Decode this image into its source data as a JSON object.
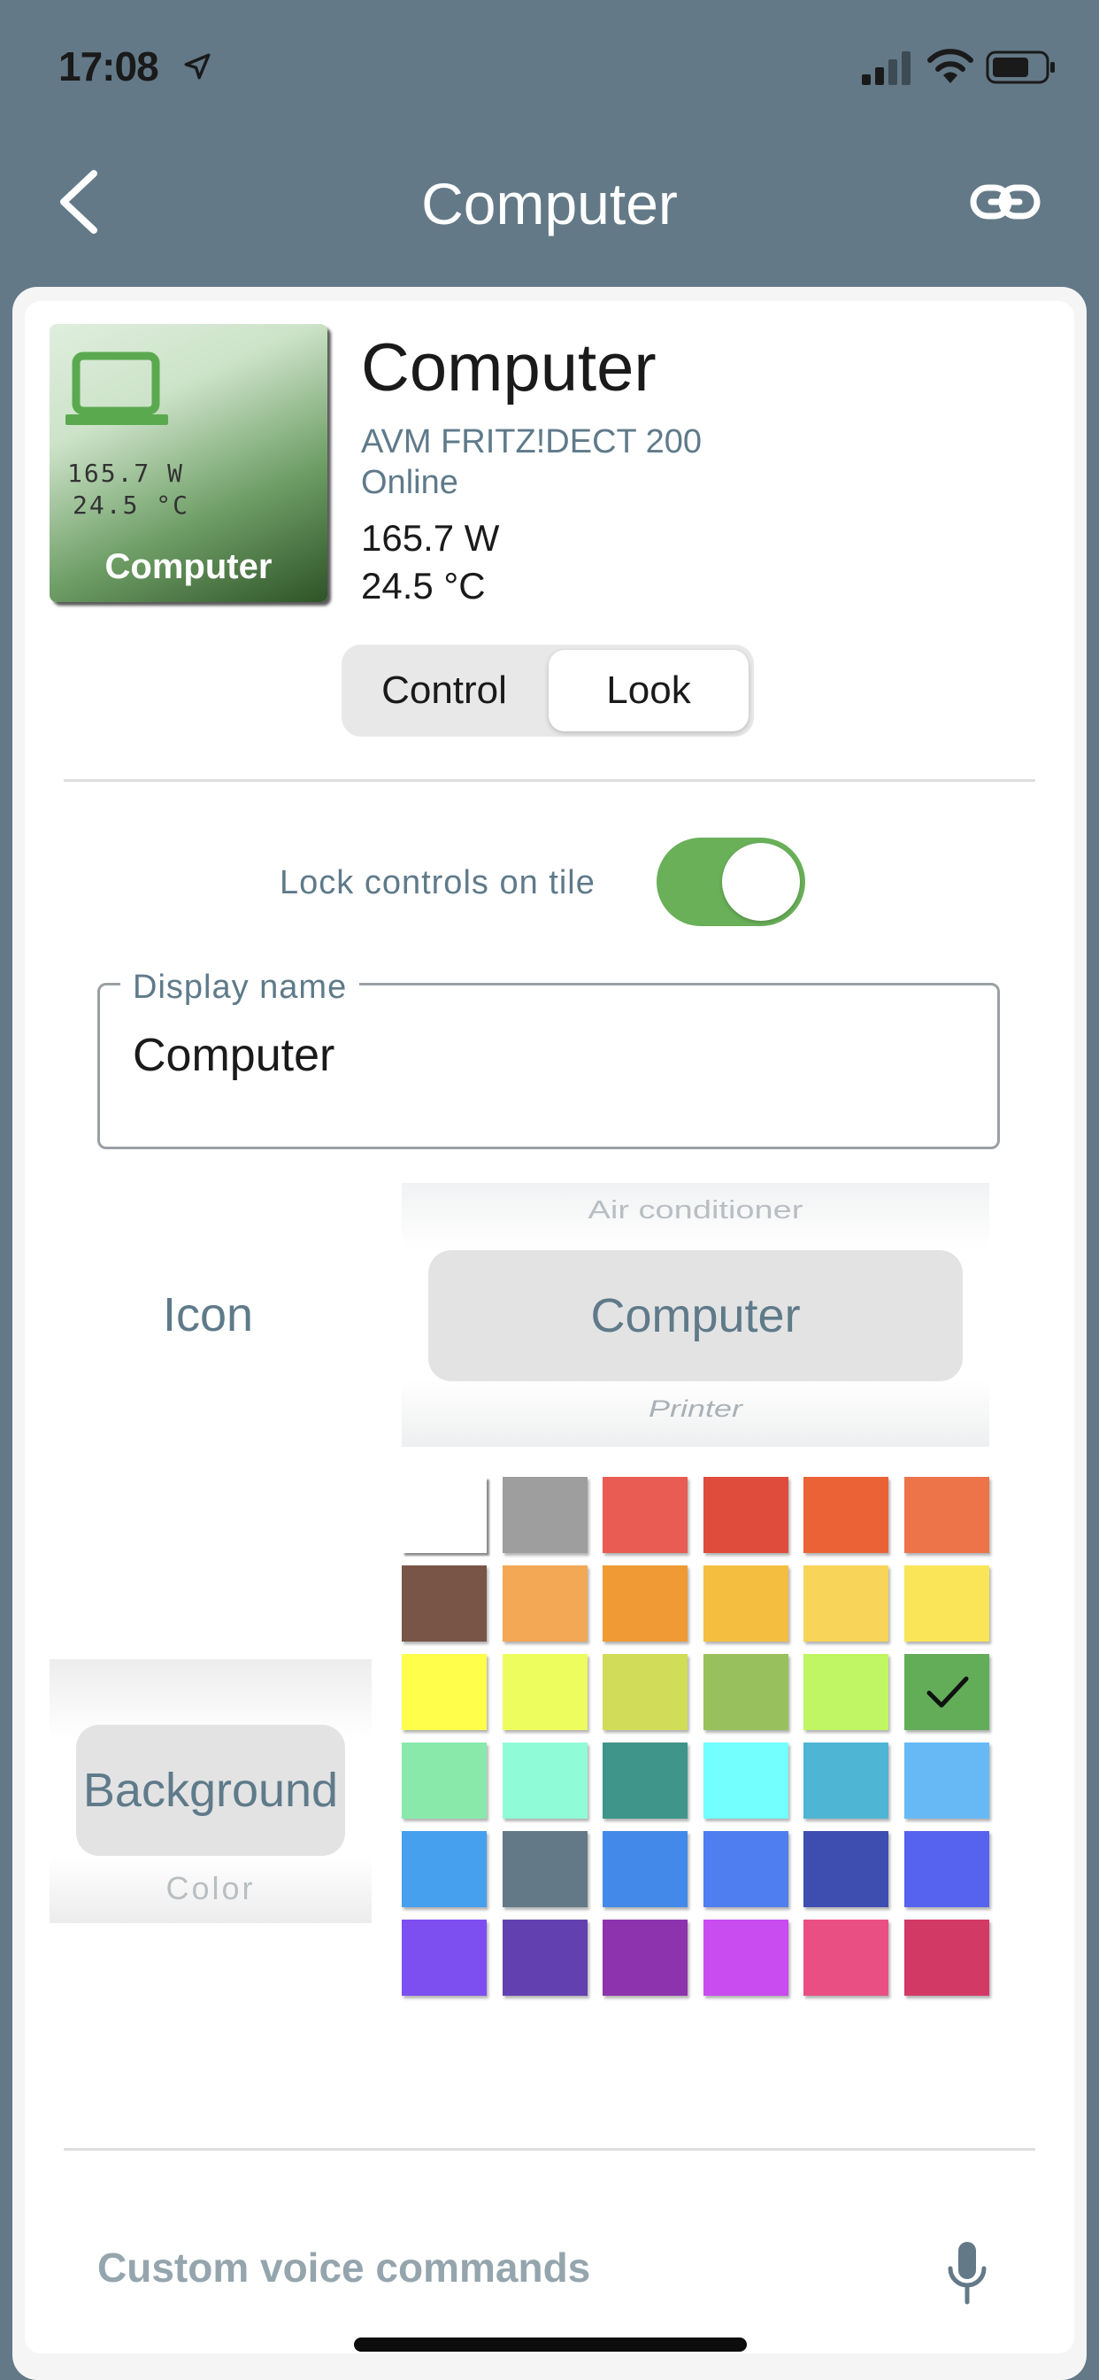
{
  "status_bar": {
    "time": "17:08",
    "icons": [
      "location-arrow-icon",
      "cellular-signal-icon",
      "wifi-icon",
      "battery-icon"
    ]
  },
  "nav": {
    "title": "Computer",
    "back_icon": "chevron-left-icon",
    "action_icon": "link-icon"
  },
  "device": {
    "tile": {
      "icon": "laptop-icon",
      "power": "165.7 W",
      "temperature": "24.5 °C",
      "name": "Computer",
      "colors": {
        "icon": "#5aa94f",
        "gradient_light": "#dfeedd",
        "gradient_dark": "#2e5327"
      }
    },
    "name": "Computer",
    "model": "AVM FRITZ!DECT 200",
    "status": "Online",
    "power": "165.7 W",
    "temperature": "24.5 °C"
  },
  "tabs": [
    {
      "label": "Control",
      "selected": false
    },
    {
      "label": "Look",
      "selected": true
    }
  ],
  "look": {
    "lock_controls_label": "Lock controls on tile",
    "lock_controls_on": true,
    "display_name_label": "Display name",
    "display_name_value": "Computer",
    "icon_label": "Icon",
    "icon_picker": {
      "previous": "Air conditioner",
      "selected": "Computer",
      "next": "Printer"
    },
    "background_picker": {
      "selected": "Background",
      "next": "Color"
    },
    "palette": [
      "#ffffff",
      "#9e9e9e",
      "#e85c54",
      "#df4c3c",
      "#ea6236",
      "#ed7449",
      "#795548",
      "#f2a854",
      "#ef9a34",
      "#f4bf40",
      "#f8d458",
      "#fae559",
      "#ffff4b",
      "#eefd5e",
      "#d1dd58",
      "#98c05c",
      "#c0f663",
      "#63ad59",
      "#89e9ab",
      "#90fcd7",
      "#3f9589",
      "#74ffff",
      "#4fb5d4",
      "#67b9f6",
      "#46a0ee",
      "#637988",
      "#4389e9",
      "#4e7eef",
      "#3e4db0",
      "#5663ef",
      "#7d4ef0",
      "#6340b0",
      "#8d33ad",
      "#c84cef",
      "#ea4f84",
      "#d33965"
    ],
    "palette_selected_index": 17
  },
  "voice": {
    "label": "Custom voice commands",
    "icon": "microphone-icon"
  },
  "colors": {
    "header_bg": "#637988",
    "accent_green": "#69b059",
    "muted_text": "#5f7a8a"
  }
}
